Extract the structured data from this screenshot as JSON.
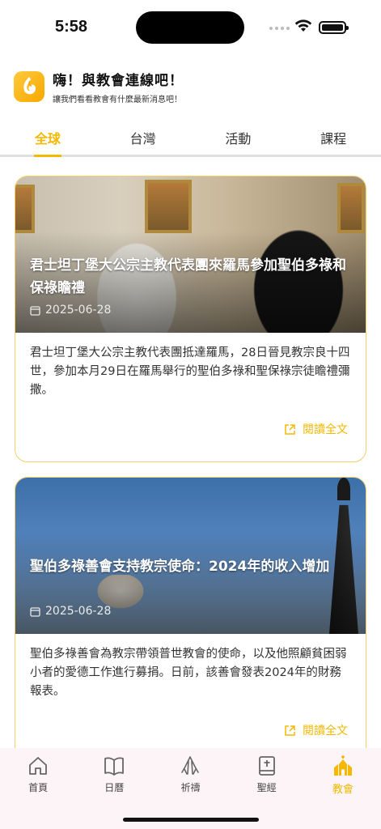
{
  "status": {
    "time": "5:58"
  },
  "header": {
    "title": "嗨！與教會連線吧！",
    "subtitle": "讓我們看看教會有什麼最新消息吧！"
  },
  "tabs": [
    {
      "label": "全球",
      "active": true
    },
    {
      "label": "台灣",
      "active": false
    },
    {
      "label": "活動",
      "active": false
    },
    {
      "label": "課程",
      "active": false
    }
  ],
  "articles": [
    {
      "title": "君士坦丁堡大公宗主教代表團來羅馬參加聖伯多祿和保祿瞻禮",
      "date": "2025-06-28",
      "summary": "君士坦丁堡大公宗主教代表團抵達羅馬，28日晉見教宗良十四世，參加本月29日在羅馬舉行的聖伯多祿和聖保祿宗徒瞻禮彌撒。",
      "read_more": "閱讀全文"
    },
    {
      "title": "聖伯多祿善會支持教宗使命：2024年的收入增加",
      "date": "2025-06-28",
      "summary": "聖伯多祿善會為教宗帶領普世教會的使命，以及他照顧貧困弱小者的愛德工作進行募捐。日前，該善會發表2024年的財務報表。",
      "read_more": "閱讀全文"
    }
  ],
  "bottom_nav": [
    {
      "label": "首頁",
      "icon": "home-icon",
      "active": false
    },
    {
      "label": "日曆",
      "icon": "book-icon",
      "active": false
    },
    {
      "label": "祈禱",
      "icon": "pray-icon",
      "active": false
    },
    {
      "label": "聖經",
      "icon": "bible-icon",
      "active": false
    },
    {
      "label": "教會",
      "icon": "church-icon",
      "active": true
    }
  ],
  "colors": {
    "accent": "#f5b800",
    "card_border": "#f6cf6a",
    "nav_bg": "#fdf4f8"
  }
}
